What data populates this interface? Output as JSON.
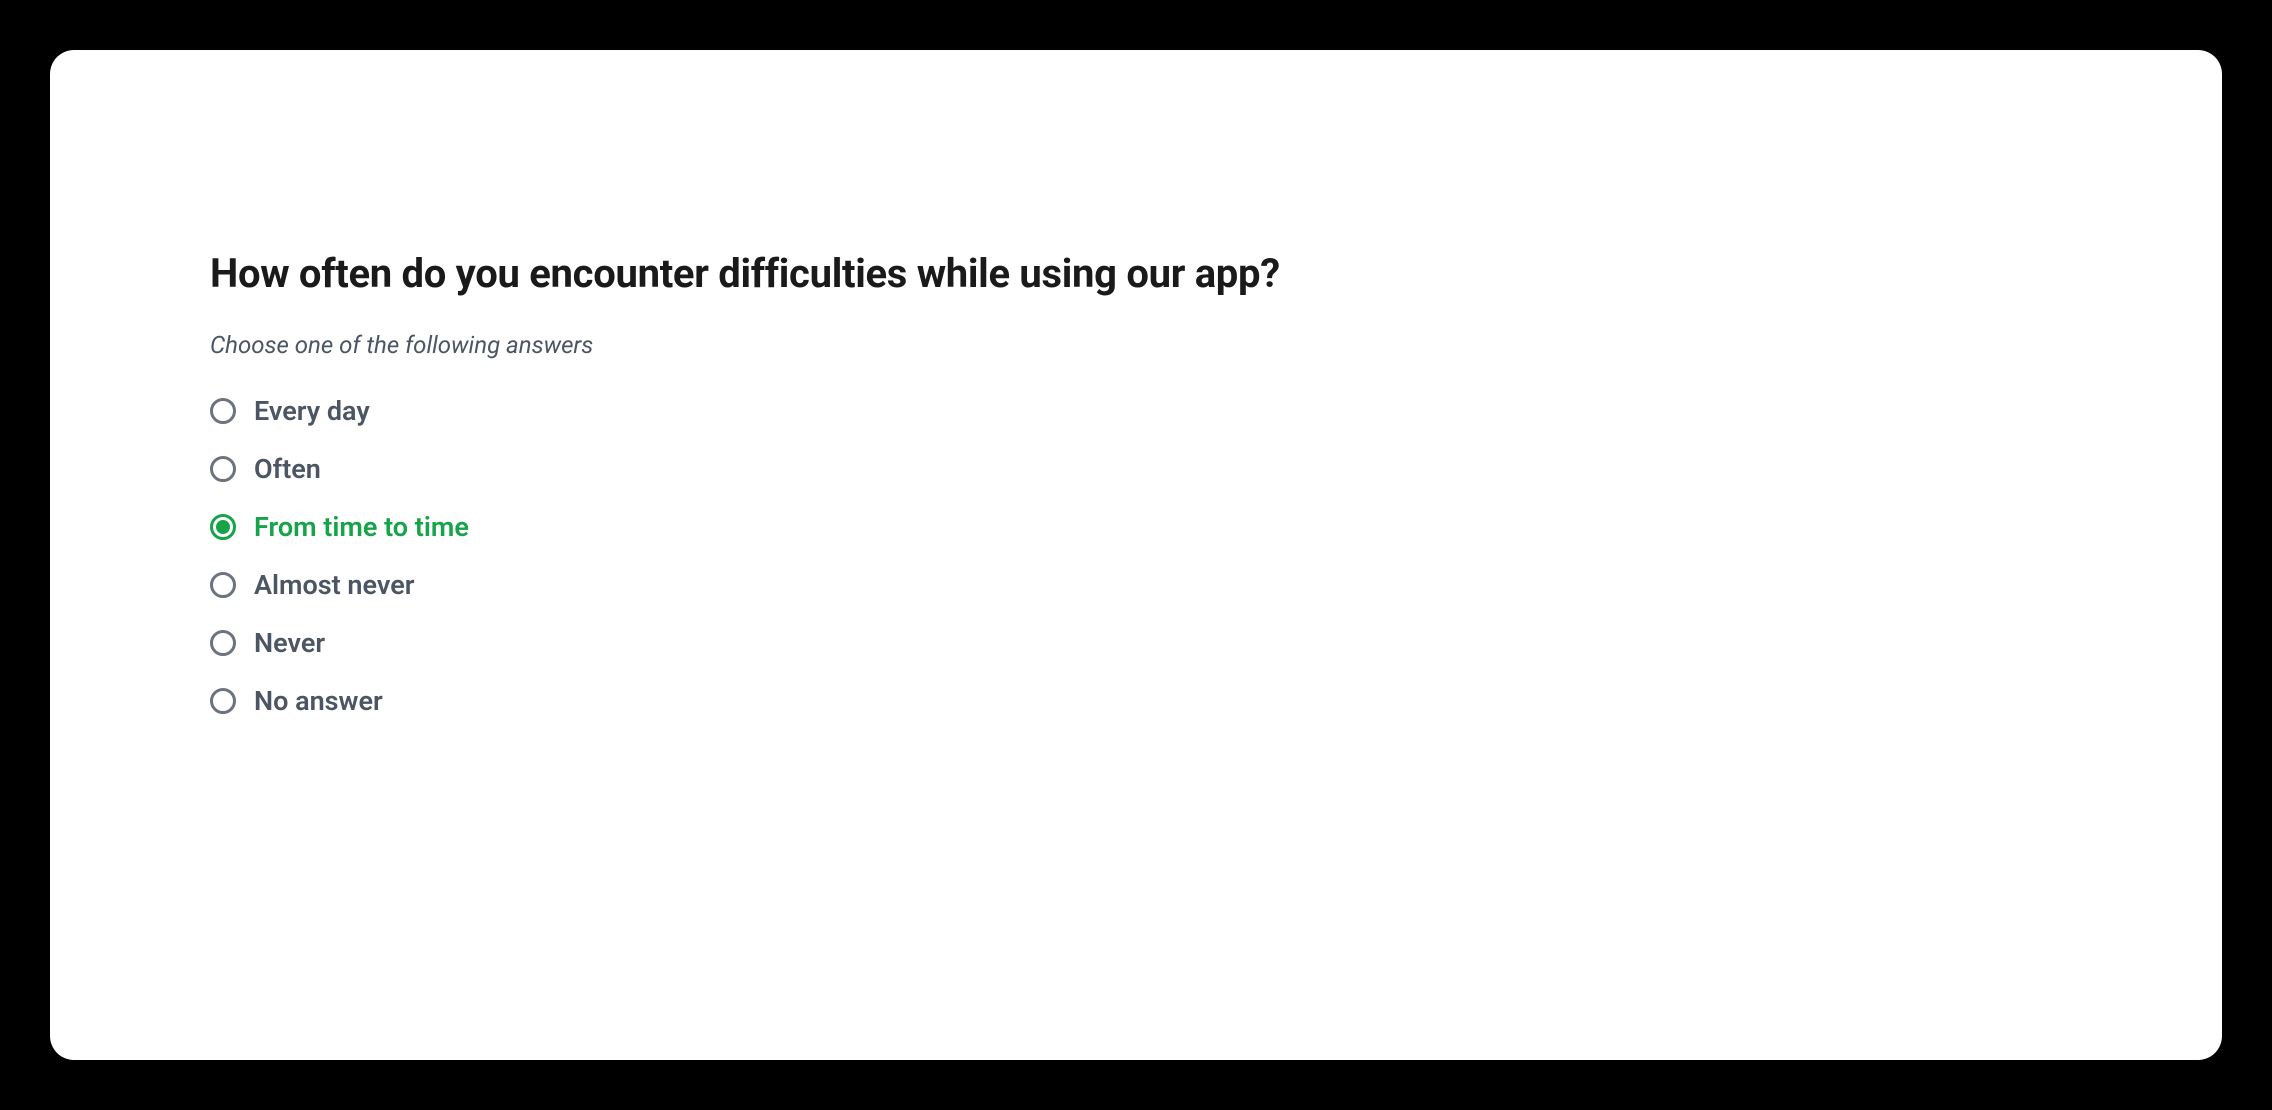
{
  "question": {
    "title": "How often do you encounter difficulties while using our app?",
    "instruction": "Choose one of the following answers",
    "selectedIndex": 2,
    "options": [
      {
        "label": "Every day"
      },
      {
        "label": "Often"
      },
      {
        "label": "From time to time"
      },
      {
        "label": "Almost never"
      },
      {
        "label": "Never"
      },
      {
        "label": "No answer"
      }
    ]
  },
  "colors": {
    "accent": "#16a34a",
    "text": "#4b5563",
    "title": "#1a1a1a"
  }
}
